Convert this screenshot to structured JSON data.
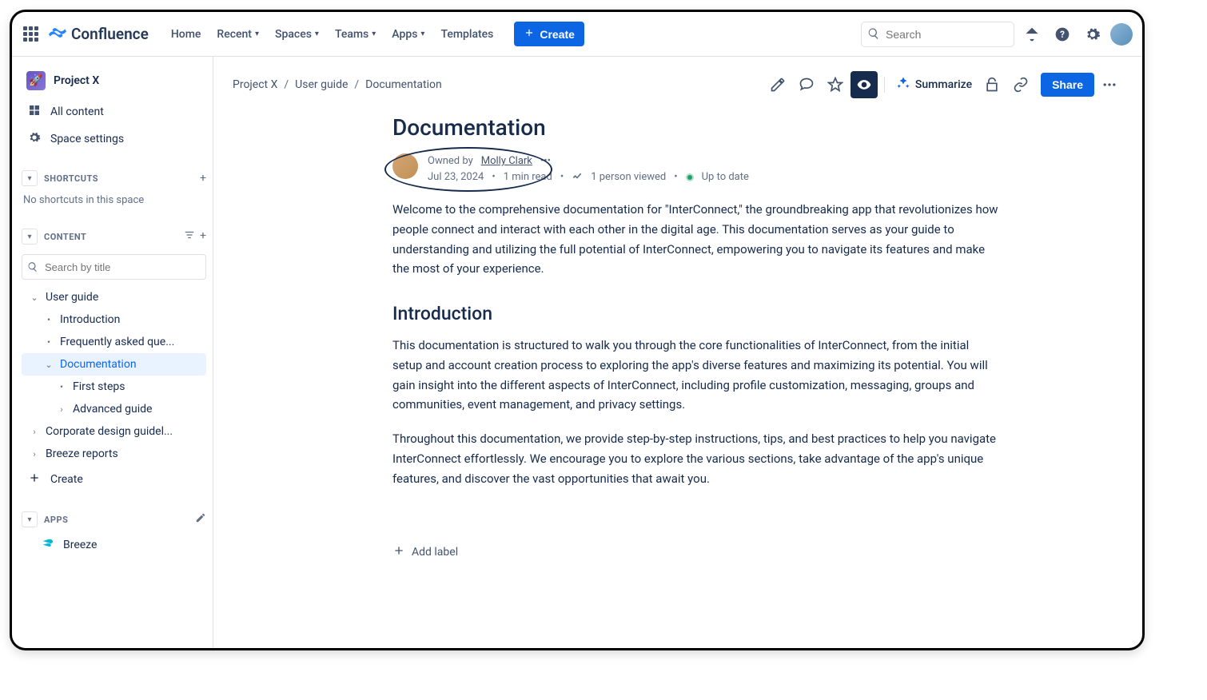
{
  "header": {
    "brand": "Confluence",
    "nav": {
      "home": "Home",
      "recent": "Recent",
      "spaces": "Spaces",
      "teams": "Teams",
      "apps": "Apps",
      "templates": "Templates"
    },
    "create": "Create",
    "search_placeholder": "Search"
  },
  "sidebar": {
    "space_name": "Project X",
    "all_content": "All content",
    "space_settings": "Space settings",
    "sections": {
      "shortcuts": "SHORTCUTS",
      "content": "CONTENT",
      "apps": "APPS"
    },
    "no_shortcuts": "No shortcuts in this space",
    "search_placeholder": "Search by title",
    "tree": {
      "user_guide": "User guide",
      "introduction": "Introduction",
      "faq": "Frequently asked que...",
      "documentation": "Documentation",
      "first_steps": "First steps",
      "advanced": "Advanced guide",
      "corporate": "Corporate design guidel...",
      "breeze_reports": "Breeze reports"
    },
    "create": "Create",
    "breeze": "Breeze"
  },
  "page": {
    "breadcrumbs": {
      "b0": "Project X",
      "b1": "User guide",
      "b2": "Documentation"
    },
    "actions": {
      "summarize": "Summarize",
      "share": "Share"
    },
    "title": "Documentation",
    "byline": {
      "owned_by": "Owned by ",
      "owner_name": "Molly Clark",
      "date": "Jul 23, 2024",
      "read_time": "1 min read",
      "views": "1 person viewed",
      "status": "Up to date"
    },
    "body": {
      "intro": "Welcome to the comprehensive documentation for \"InterConnect,\" the groundbreaking app that revolutionizes how people connect and interact with each other in the digital age. This documentation serves as your guide to understanding and utilizing the full potential of InterConnect, empowering you to navigate its features and make the most of your experience.",
      "h2": "Introduction",
      "p1": "This documentation is structured to walk you through the core functionalities of InterConnect, from the initial setup and account creation process to exploring the app's diverse features and maximizing its potential. You will gain insight into the different aspects of InterConnect, including profile customization, messaging, groups and communities, event management, and privacy settings.",
      "p2": "Throughout this documentation, we provide step-by-step instructions, tips, and best practices to help you navigate InterConnect effortlessly. We encourage you to explore the various sections, take advantage of the app's unique features, and discover the vast opportunities that await you."
    },
    "add_label": "Add label"
  }
}
